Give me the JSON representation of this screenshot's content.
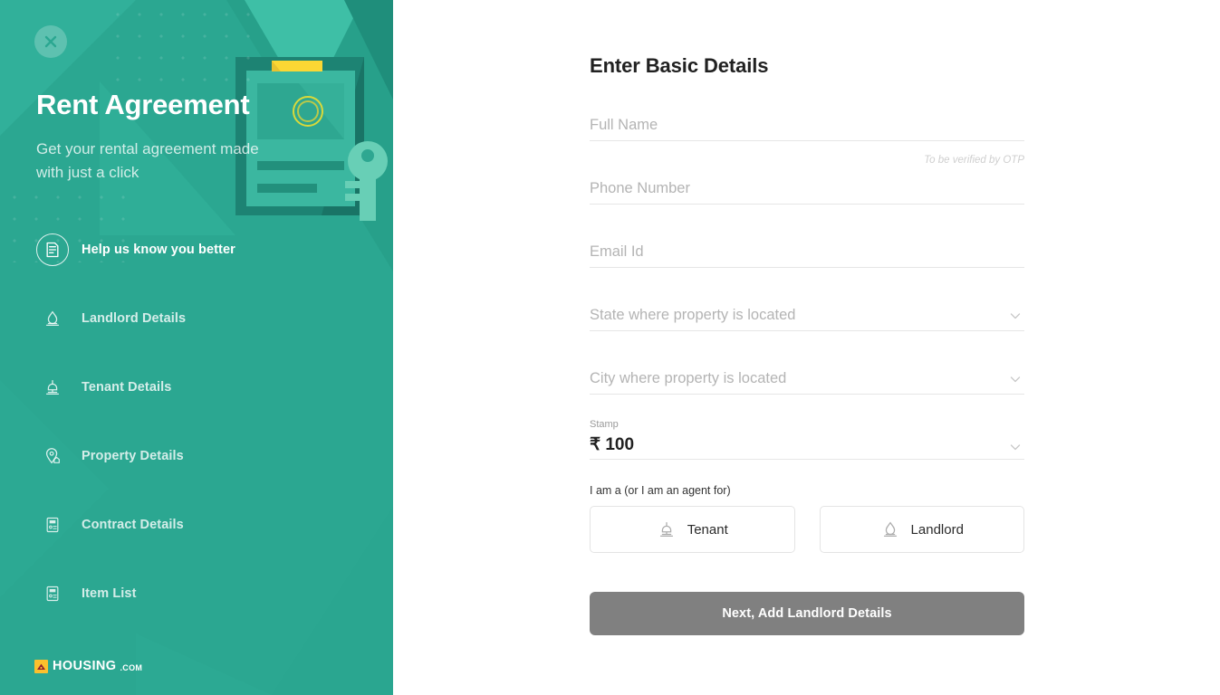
{
  "sidebar": {
    "close_icon": "close-icon",
    "title": "Rent Agreement",
    "subtitle": "Get your rental agreement made with just a click",
    "nav": [
      {
        "label": "Help us know you better",
        "icon": "document-icon",
        "active": true
      },
      {
        "label": "Landlord Details",
        "icon": "landlord-icon",
        "active": false
      },
      {
        "label": "Tenant Details",
        "icon": "tenant-icon",
        "active": false
      },
      {
        "label": "Property Details",
        "icon": "location-home-icon",
        "active": false
      },
      {
        "label": "Contract Details",
        "icon": "contract-icon",
        "active": false
      },
      {
        "label": "Item List",
        "icon": "list-icon",
        "active": false
      }
    ],
    "brand": {
      "mark_icon": "housing-roof-icon",
      "name": "HOUSING",
      "tld": ".COM"
    },
    "colors": {
      "background": "#2ba791",
      "title_text": "#ffffff",
      "accent_yellow": "#fbc02d",
      "illustration_dark": "#1d8373",
      "illustration_light": "#5ec9ae"
    }
  },
  "main": {
    "heading": "Enter Basic Details",
    "fields": [
      {
        "name": "full_name",
        "placeholder": "Full Name",
        "value": "",
        "hint": ""
      },
      {
        "name": "phone_number",
        "placeholder": "Phone Number",
        "value": "",
        "hint": "To be verified by OTP"
      },
      {
        "name": "email_id",
        "placeholder": "Email Id",
        "value": "",
        "hint": ""
      }
    ],
    "selects": [
      {
        "name": "state",
        "placeholder": "State where property is located",
        "value": "",
        "icon": "chevron-down-icon"
      },
      {
        "name": "city",
        "placeholder": "City where property is located",
        "value": "",
        "icon": "chevron-down-icon"
      }
    ],
    "stamp": {
      "label": "Stamp",
      "value": "₹ 100",
      "icon": "chevron-down-icon"
    },
    "role": {
      "label": "I am a (or I am an agent for)",
      "options": [
        {
          "label": "Tenant",
          "icon": "tenant-icon",
          "selected": false
        },
        {
          "label": "Landlord",
          "icon": "landlord-icon",
          "selected": false
        }
      ]
    },
    "submit_label": "Next, Add Landlord Details",
    "colors": {
      "heading_text": "#212121",
      "placeholder_text": "#b4b4b4",
      "underline": "#e6e6e6",
      "submit_background": "#808080",
      "submit_text": "#ffffff"
    }
  }
}
